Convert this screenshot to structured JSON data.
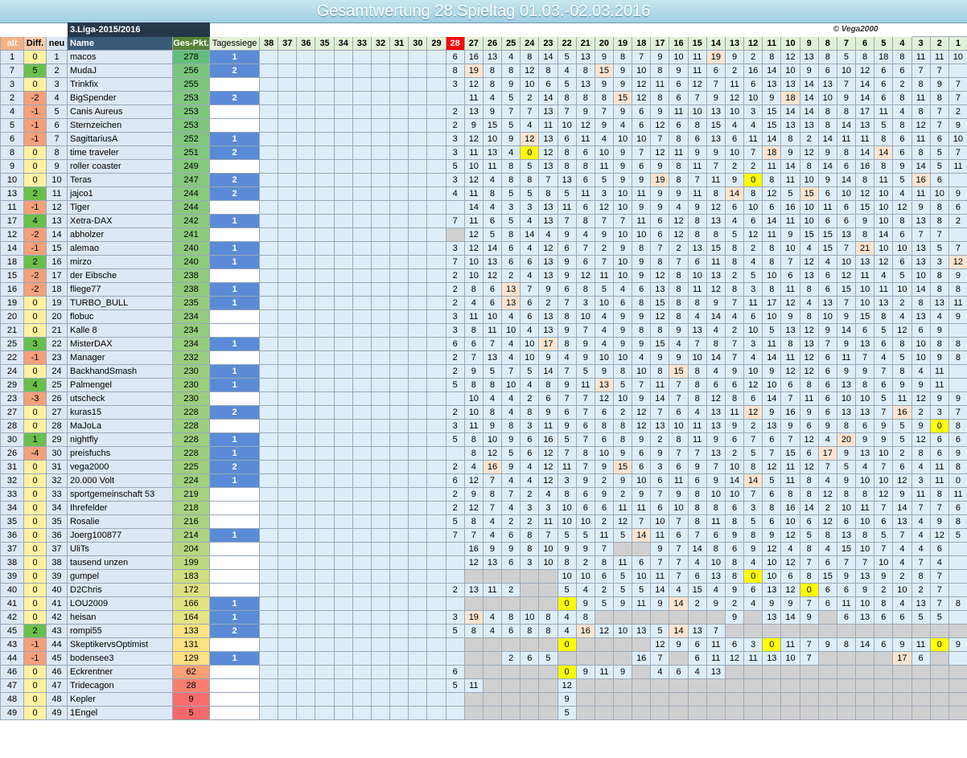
{
  "title": "Gesamtwertung 28.Spieltag 01.03.-02.03.2016",
  "league": "3.Liga-2015/2016",
  "copyright": "© Vega2000",
  "headers": {
    "alt": "alt",
    "diff": "Diff.",
    "neu": "neu",
    "name": "Name",
    "pkt": "Ges-Pkt.",
    "tag": "Tagessiege"
  },
  "spieltage": [
    "38",
    "37",
    "36",
    "35",
    "34",
    "33",
    "32",
    "31",
    "30",
    "29",
    "28",
    "27",
    "26",
    "25",
    "24",
    "23",
    "22",
    "21",
    "20",
    "19",
    "18",
    "17",
    "16",
    "15",
    "14",
    "13",
    "12",
    "11",
    "10",
    "9",
    "8",
    "7",
    "6",
    "5",
    "4",
    "3",
    "2",
    "1"
  ],
  "current_spieltag": "28",
  "colors": {
    "diff_pos": "#6abf4b",
    "diff_neg": "#f4a07a",
    "diff_zero": "#fff2a0",
    "highlight": "#fce4d0",
    "zero_score": "#ffff00",
    "empty": "#d0d0d0"
  },
  "rows": [
    {
      "alt": "1",
      "diff": "0",
      "neu": "1",
      "name": "macos",
      "pkt": "278",
      "tag": "1",
      "s": "6|16|13|4|8|14|5|13|9|8|7|9|10|11|19*|9|2|8|12|13|8|5|8|18|8|11|11|10|8"
    },
    {
      "alt": "7",
      "diff": "5",
      "neu": "2",
      "name": "MudaJ",
      "pkt": "256",
      "tag": "2",
      "s": "8|19*|8|8|12|8|4|8|15*|9|10|8|9|11|6|2|16|14|10|9|6|10|12|6|6|7|7"
    },
    {
      "alt": "3",
      "diff": "0",
      "neu": "3",
      "name": "Trinkfix",
      "pkt": "255",
      "tag": "",
      "s": "3|12|8|9|10|6|5|13|9|9|12|11|6|12|7|11|6|13|13|14|13|7|14|6|2|8|9|7"
    },
    {
      "alt": "2",
      "diff": "-2",
      "neu": "4",
      "name": "BigSpender",
      "pkt": "253",
      "tag": "2",
      "s": "|11|4|5|2|14|8|8|8|15*|12|8|6|7|9|12|10|9|18*|14|10|9|14|6|8|11|8|7"
    },
    {
      "alt": "4",
      "diff": "-1",
      "neu": "5",
      "name": "Canis Aureus",
      "pkt": "253",
      "tag": "",
      "s": "2|13|9|7|7|13|7|9|7|9|6|9|11|10|13|10|3|15|14|14|8|8|17|11|4|8|7|2"
    },
    {
      "alt": "5",
      "diff": "-1",
      "neu": "6",
      "name": "Sternzeichen",
      "pkt": "253",
      "tag": "",
      "s": "2|9|15|5|4|11|10|12|9|4|6|12|6|8|15|4|4|15|13|13|8|14|13|5|8|12|7|9"
    },
    {
      "alt": "6",
      "diff": "-1",
      "neu": "7",
      "name": "SagittariusA",
      "pkt": "252",
      "tag": "1",
      "s": "3|12|10|9|12*|13|6|11|4|10|10|7|8|6|13|6|11|14|8|2|14|11|11|8|6|11|6|10"
    },
    {
      "alt": "8",
      "diff": "0",
      "neu": "8",
      "name": "time traveler",
      "pkt": "251",
      "tag": "2",
      "s": "3|11|13|4|0!|12|8|6|10|9|7|12|11|9|9|10|7|18*|9|12|9|8|14|14*|6|8|5|7"
    },
    {
      "alt": "9",
      "diff": "0",
      "neu": "9",
      "name": "roller coaster",
      "pkt": "249",
      "tag": "",
      "s": "5|10|11|8|5|13|8|8|11|9|6|9|8|11|7|2|2|11|14|8|14|6|16|8|9|14|5|11"
    },
    {
      "alt": "10",
      "diff": "0",
      "neu": "10",
      "name": "Teras",
      "pkt": "247",
      "tag": "2",
      "s": "3|12|4|8|8|7|13|6|5|9|9|19*|8|7|11|9|0!|8|11|10|9|14|8|11|5|16*|6"
    },
    {
      "alt": "13",
      "diff": "2",
      "neu": "11",
      "name": "jajco1",
      "pkt": "244",
      "tag": "2",
      "s": "4|11|8|5|5|8|5|11|3|10|11|9|9|11|8|14*|8|12|5|15*|6|10|12|10|4|11|10|9"
    },
    {
      "alt": "11",
      "diff": "-1",
      "neu": "12",
      "name": "Tiger",
      "pkt": "244",
      "tag": "",
      "s": "|14|4|3|3|13|11|6|12|10|9|9|4|9|12|6|10|6|16|10|11|6|15|10|12|9|8|6"
    },
    {
      "alt": "17",
      "diff": "4",
      "neu": "13",
      "name": "Xetra-DAX",
      "pkt": "242",
      "tag": "1",
      "s": "7|11|6|5|4|13|7|8|7|7|11|6|12|8|13|4|6|14|11|10|6|6|9|10|8|13|8|2"
    },
    {
      "alt": "12",
      "diff": "-2",
      "neu": "14",
      "name": "abholzer",
      "pkt": "241",
      "tag": "",
      "s": "~|12|5|8|14|4|9|4|9|10|10|6|12|8|8|5|12|11|9|15|15|13|8|14|6|7|7"
    },
    {
      "alt": "14",
      "diff": "-1",
      "neu": "15",
      "name": "alemao",
      "pkt": "240",
      "tag": "1",
      "s": "3|12|14|6|4|12|6|7|2|9|8|7|2|13|15|8|2|8|10|4|15|7|21*|10|10|13|5|7"
    },
    {
      "alt": "18",
      "diff": "2",
      "neu": "16",
      "name": "mirzo",
      "pkt": "240",
      "tag": "1",
      "s": "7|10|13|6|6|13|9|6|7|10|9|8|7|6|11|8|4|8|7|12|4|10|13|12|6|13|3|12*"
    },
    {
      "alt": "15",
      "diff": "-2",
      "neu": "17",
      "name": "der Eibsche",
      "pkt": "238",
      "tag": "",
      "s": "2|10|12|2|4|13|9|12|11|10|9|12|8|10|13|2|5|10|6|13|6|12|11|4|5|10|8|9"
    },
    {
      "alt": "16",
      "diff": "-2",
      "neu": "18",
      "name": "fliege77",
      "pkt": "238",
      "tag": "1",
      "s": "2|8|6|13*|7|9|6|8|5|4|6|13|8|11|12|8|3|8|11|8|6|15|10|11|10|14|8|8"
    },
    {
      "alt": "19",
      "diff": "0",
      "neu": "19",
      "name": "TURBO_BULL",
      "pkt": "235",
      "tag": "1",
      "s": "2|4|6|13*|6|2|7|3|10|6|8|15|8|8|9|7|11|17|12|4|13|7|10|13|2|8|13|11"
    },
    {
      "alt": "20",
      "diff": "0",
      "neu": "20",
      "name": "flobuc",
      "pkt": "234",
      "tag": "",
      "s": "3|11|10|4|6|13|8|10|4|9|9|12|8|4|14|4|6|10|9|8|10|9|15|8|4|13|4|9"
    },
    {
      "alt": "21",
      "diff": "0",
      "neu": "21",
      "name": "Kalle 8",
      "pkt": "234",
      "tag": "",
      "s": "3|8|11|10|4|13|9|7|4|9|8|8|9|13|4|2|10|5|13|12|9|14|6|5|12|6|9"
    },
    {
      "alt": "25",
      "diff": "3",
      "neu": "22",
      "name": "MisterDAX",
      "pkt": "234",
      "tag": "1",
      "s": "6|6|7|4|10|17*|8|9|4|9|9|15|4|7|8|7|3|11|8|13|7|9|13|6|8|10|8|8"
    },
    {
      "alt": "22",
      "diff": "-1",
      "neu": "23",
      "name": "Manager",
      "pkt": "232",
      "tag": "",
      "s": "2|7|13|4|10|9|4|9|10|10|4|9|9|10|14|7|4|14|11|12|6|11|7|4|5|10|9|8"
    },
    {
      "alt": "24",
      "diff": "0",
      "neu": "24",
      "name": "BackhandSmash",
      "pkt": "230",
      "tag": "1",
      "s": "2|9|5|7|5|14|7|5|9|8|10|8|15*|8|4|9|10|9|12|12|6|9|9|7|8|4|11"
    },
    {
      "alt": "29",
      "diff": "4",
      "neu": "25",
      "name": "Palmengel",
      "pkt": "230",
      "tag": "1",
      "s": "5|8|8|10|4|8|9|11|13*|5|7|11|7|8|6|6|12|10|6|8|6|13|8|6|9|9|11"
    },
    {
      "alt": "23",
      "diff": "-3",
      "neu": "26",
      "name": "utscheck",
      "pkt": "230",
      "tag": "",
      "s": "|10|4|4|2|6|7|7|12|10|9|14|7|8|12|8|6|14|7|11|6|10|10|5|11|12|9|9"
    },
    {
      "alt": "27",
      "diff": "0",
      "neu": "27",
      "name": "kuras15",
      "pkt": "228",
      "tag": "2",
      "s": "2|10|8|4|8|9|6|7|6|2|12|7|6|4|13|11|12*|9|16|9|6|13|13|7|16*|2|3|7"
    },
    {
      "alt": "28",
      "diff": "0",
      "neu": "28",
      "name": "MaJoLa",
      "pkt": "228",
      "tag": "",
      "s": "3|11|9|8|3|11|9|6|8|8|12|13|10|11|13|9|2|13|9|6|9|8|6|9|5|9|0!|8"
    },
    {
      "alt": "30",
      "diff": "1",
      "neu": "29",
      "name": "nightfly",
      "pkt": "228",
      "tag": "1",
      "s": "5|8|10|9|6|16|5|7|6|8|9|2|8|11|9|6|7|6|7|12|4|20*|9|9|5|12|6|6"
    },
    {
      "alt": "26",
      "diff": "-4",
      "neu": "30",
      "name": "preisfuchs",
      "pkt": "228",
      "tag": "1",
      "s": "|8|12|5|6|12|7|8|10|9|6|9|7|7|13|2|5|7|15|6|17*|9|13|10|2|8|6|9"
    },
    {
      "alt": "31",
      "diff": "0",
      "neu": "31",
      "name": "vega2000",
      "pkt": "225",
      "tag": "2",
      "s": "2|4|16*|9|4|12|11|7|9|15*|6|3|6|9|7|10|8|12|11|12|7|5|4|7|6|4|11|8"
    },
    {
      "alt": "32",
      "diff": "0",
      "neu": "32",
      "name": "20.000 Volt",
      "pkt": "224",
      "tag": "1",
      "s": "6|12|7|4|4|12|3|9|2|9|10|6|11|6|9|14|14*|5|11|8|4|9|10|10|12|3|11|0"
    },
    {
      "alt": "33",
      "diff": "0",
      "neu": "33",
      "name": "sportgemeinschaft 53",
      "pkt": "219",
      "tag": "",
      "s": "2|9|8|7|2|4|8|6|9|2|9|7|9|8|10|10|7|6|8|8|12|8|8|12|9|11|8|11|9"
    },
    {
      "alt": "34",
      "diff": "0",
      "neu": "34",
      "name": "Ihrefelder",
      "pkt": "218",
      "tag": "",
      "s": "2|12|7|4|3|3|10|6|6|11|11|6|10|8|8|6|3|8|16|14|2|10|11|7|14|7|7|6"
    },
    {
      "alt": "35",
      "diff": "0",
      "neu": "35",
      "name": "Rosalie",
      "pkt": "216",
      "tag": "",
      "s": "5|8|4|2|2|11|10|10|2|12|7|10|7|8|11|8|5|6|10|6|12|6|10|6|13|4|9|8"
    },
    {
      "alt": "36",
      "diff": "0",
      "neu": "36",
      "name": "Joerg100877",
      "pkt": "214",
      "tag": "1",
      "s": "7|7|4|6|8|7|5|5|11|5|14*|11|6|7|6|9|8|9|12|5|8|13|8|5|7|4|12|5|6"
    },
    {
      "alt": "37",
      "diff": "0",
      "neu": "37",
      "name": "UliTs",
      "pkt": "204",
      "tag": "",
      "s": "|16|9|9|8|10|9|9|7|~|~|9|7|14|8|6|9|12|4|8|4|15|10|7|4|4|6"
    },
    {
      "alt": "38",
      "diff": "0",
      "neu": "38",
      "name": "tausend unzen",
      "pkt": "199",
      "tag": "",
      "s": "|12|13|6|3|10|8|2|8|11|6|7|7|4|10|8|4|10|12|7|6|7|7|10|4|7|4"
    },
    {
      "alt": "39",
      "diff": "0",
      "neu": "39",
      "name": "gumpel",
      "pkt": "183",
      "tag": "",
      "s": "|~|~|~|~|~|10|10|6|5|10|11|7|6|13|8|0!|10|6|8|15|9|13|9|2|8|7"
    },
    {
      "alt": "40",
      "diff": "0",
      "neu": "40",
      "name": "D2Chris",
      "pkt": "172",
      "tag": "",
      "s": "2|13|11|2|~|~|5|4|2|5|5|14|4|15|4|9|6|13|12|0!|6|6|9|2|10|2|7"
    },
    {
      "alt": "41",
      "diff": "0",
      "neu": "41",
      "name": "LOU2009",
      "pkt": "166",
      "tag": "1",
      "s": "|~|~|~|~|~|0!|9|5|9|11|9|14*|2|9|2|4|9|9|7|6|11|10|8|4|13|7|8"
    },
    {
      "alt": "42",
      "diff": "0",
      "neu": "42",
      "name": "heisan",
      "pkt": "164",
      "tag": "1",
      "s": "3|19*|4|8|10|8|4|8|~|~|~|~|~|~|~|9|~|13|14|9|~|6|13|6|6|5|5"
    },
    {
      "alt": "45",
      "diff": "2",
      "neu": "43",
      "name": "rompi55",
      "pkt": "133",
      "tag": "2",
      "s": "5|8|4|6|8|8|4|16*|12|10|13|5|14*|13|7|~|~|~|~|~|~|~|~|~|~|~|~|~"
    },
    {
      "alt": "43",
      "diff": "-1",
      "neu": "44",
      "name": "SkeptikervsOptimist",
      "pkt": "131",
      "tag": "",
      "s": "|~|~|~|~|~|0!|~|~|~|~|12|9|6|11|6|3|0!|11|7|9|8|14|6|9|11|0!|9"
    },
    {
      "alt": "44",
      "diff": "-1",
      "neu": "45",
      "name": "bodensee3",
      "pkt": "129",
      "tag": "1",
      "s": "|~|~|2|6|5|~|~|~|~|16|7|~|6|11|12|11|13|10|7|~|~|~|~|17*|6|~"
    },
    {
      "alt": "46",
      "diff": "0",
      "neu": "46",
      "name": "Eckrentner",
      "pkt": "62",
      "tag": "",
      "s": "6|~|~|~|~|~|0!|9|11|9|~|4|6|4|13|~|~|~|~|~|~|~|~|~|~|~|~|~"
    },
    {
      "alt": "47",
      "diff": "0",
      "neu": "47",
      "name": "Tridecagon",
      "pkt": "28",
      "tag": "",
      "s": "5|11|~|~|~|~|12|~|~|~|~|~|~|~|~|~|~|~|~|~|~|~|~|~|~|~|~|~"
    },
    {
      "alt": "48",
      "diff": "0",
      "neu": "48",
      "name": "Kepler",
      "pkt": "9",
      "tag": "",
      "s": "|~|~|~|~|~|9|~|~|~|~|~|~|~|~|~|~|~|~|~|~|~|~|~|~|~|~|~"
    },
    {
      "alt": "49",
      "diff": "0",
      "neu": "49",
      "name": "1Engel",
      "pkt": "5",
      "tag": "",
      "s": "|~|~|~|~|~|5|~|~|~|~|~|~|~|~|~|~|~|~|~|~|~|~|~|~|~|~|~"
    }
  ]
}
